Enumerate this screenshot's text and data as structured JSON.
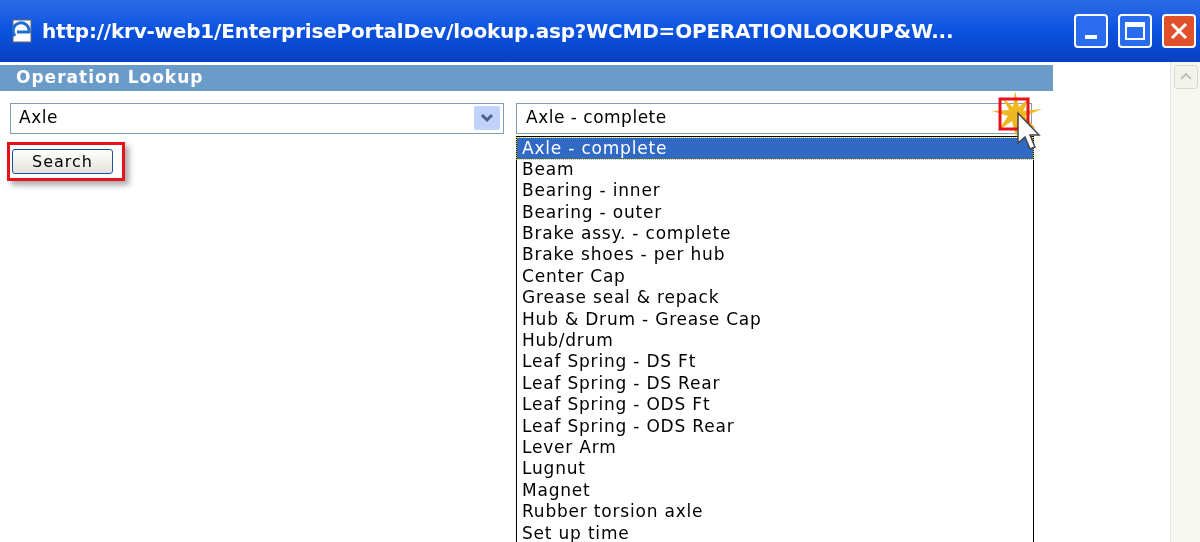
{
  "window": {
    "title": "http://krv-web1/EnterprisePortalDev/lookup.asp?WCMD=OPERATIONLOOKUP&W..."
  },
  "panel": {
    "title": "Operation Lookup"
  },
  "category_select": {
    "value": "Axle"
  },
  "operation_select": {
    "value": "Axle - complete",
    "expanded": true
  },
  "search_button": {
    "label": "Search"
  },
  "options": [
    {
      "label": "Axle - complete",
      "selected": true
    },
    {
      "label": "Beam",
      "selected": false
    },
    {
      "label": "Bearing - inner",
      "selected": false
    },
    {
      "label": "Bearing - outer",
      "selected": false
    },
    {
      "label": "Brake assy. - complete",
      "selected": false
    },
    {
      "label": "Brake shoes - per hub",
      "selected": false
    },
    {
      "label": "Center Cap",
      "selected": false
    },
    {
      "label": "Grease seal & repack",
      "selected": false
    },
    {
      "label": "Hub & Drum - Grease Cap",
      "selected": false
    },
    {
      "label": "Hub/drum",
      "selected": false
    },
    {
      "label": "Leaf Spring - DS Ft",
      "selected": false
    },
    {
      "label": "Leaf Spring - DS Rear",
      "selected": false
    },
    {
      "label": "Leaf Spring - ODS Ft",
      "selected": false
    },
    {
      "label": "Leaf Spring - ODS Rear",
      "selected": false
    },
    {
      "label": "Lever Arm",
      "selected": false
    },
    {
      "label": "Lugnut",
      "selected": false
    },
    {
      "label": "Magnet",
      "selected": false
    },
    {
      "label": "Rubber torsion axle",
      "selected": false
    },
    {
      "label": "Set up time",
      "selected": false
    }
  ]
}
